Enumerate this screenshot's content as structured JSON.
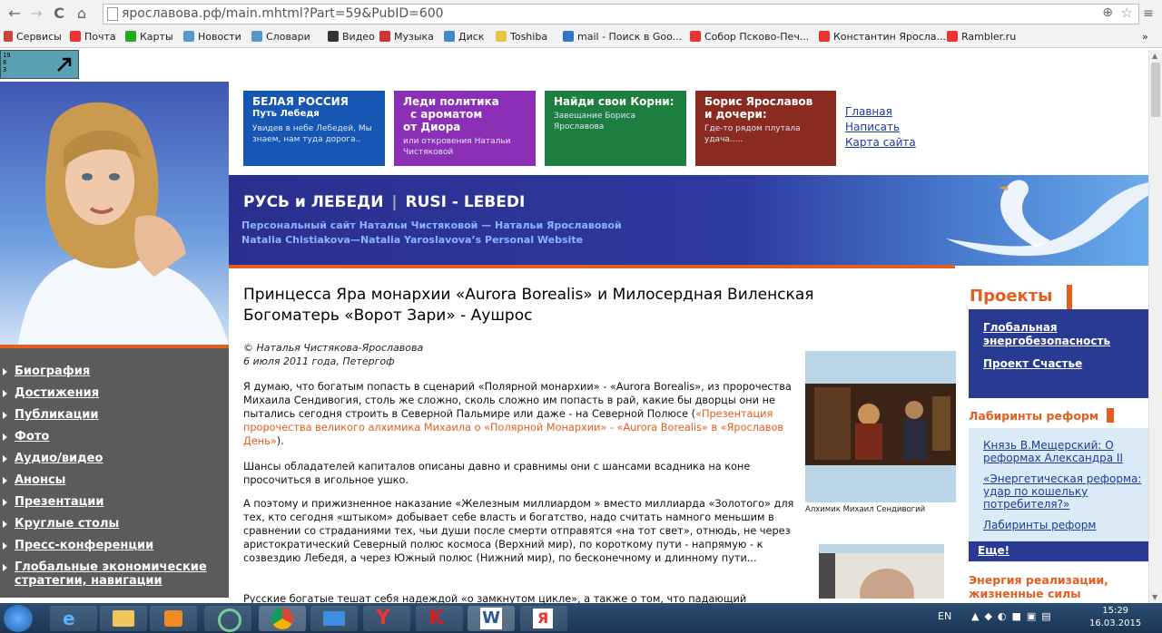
{
  "browser": {
    "url": "ярославова.рф/main.mhtml?Part=59&PubID=600",
    "bookmarks": [
      "Сервисы",
      "Почта",
      "Карты",
      "Новости",
      "Словари",
      "Видео",
      "Музыка",
      "Диск",
      "Toshiba",
      "mail - Поиск в Goo...",
      "Собор Псково-Печ...",
      "Константин Яросла...",
      "Rambler.ru"
    ],
    "bookmarks_more": "»"
  },
  "corner_badge": "19 8 3",
  "tiles": [
    {
      "title": "БЕЛАЯ  РОССИЯ",
      "title2": "Путь Лебедя",
      "sub": "Увидев в небе Лебедей, Мы знаем, нам туда дорога..",
      "color": "#1657b3"
    },
    {
      "title": "Леди  политика",
      "title2": "с  ароматом",
      "title3": "от Диора",
      "sub": "или откровения  Натальи Чистяковой",
      "color": "#8a2fb6"
    },
    {
      "title": "Найди свои Корни:",
      "sub": "Завещание Бориса Ярославова",
      "color": "#1d7e3f"
    },
    {
      "title": "Борис Ярославов",
      "title2": "и дочери:",
      "sub": "Где-то рядом плутала удача.....",
      "color": "#8b2a1e"
    }
  ],
  "toplinks": [
    "Главная",
    "Написать",
    "Карта сайта"
  ],
  "banner": {
    "title": "РУСЬ и ЛЕБЕДИ",
    "title_sep": "|",
    "title_en": "RUSI - LEBEDI",
    "sub1": "Персональный сайт Натальи Чистяковой — Натальи Ярославовой",
    "sub2": "Natalia Chistiakova—Natalia Yaroslavova’s  Personal Website"
  },
  "nav": [
    "Биография",
    "Достижения",
    "Публикации",
    "Фото",
    "Аудио/видео",
    "Анонсы",
    "Презентации",
    "Круглые столы",
    "Пресс-конференции",
    "Глобальные экономические",
    "стратегии, навигации"
  ],
  "article": {
    "title1": "Принцесса Яра монархии «Aurora Borealis» и Милосердная Виленская",
    "title2": "Богоматерь «Ворот Зари» - Аушрос",
    "author": "© Наталья Чистякова-Ярославова",
    "date": "6 июля 2011 года, Петергоф",
    "p1": "Я думаю, что богатым попасть в сценарий «Полярной монархии» - «Aurora Borealis», из пророчества Михаила Сендивогия, столь же сложно, сколь сложно им попасть в рай, какие бы дворцы они не пытались сегодня строить в Северной Пальмире или даже - на Северной Полюсе (",
    "p1_link": "«Презентация пророчества великого алхимика Михаила о «Полярной Монархии» - «Aurora Borealis» в «Ярославов День»",
    "p1_end": ").",
    "p2": "Шансы обладателей капиталов описаны давно и сравнимы они с шансами всадника на коне просочиться в игольное ушко.",
    "p3": "А поэтому и прижизненное наказание «Железным миллиардом » вместо миллиарда «Золотого» для тех, кто сегодня «штыком» добывает себе власть и богатство, надо считать намного меньшим в сравнении со страданиями тех, чьи души после смерти отправятся «на тот свет», отнюдь, не через аристократический Северный полюс космоса (Верхний мир), по короткому пути - напрямую - к созвездию Лебедя, а через Южный полюс (Нижний мир), по бесконечному и длинному пути...",
    "p4": "Русские богатые тешат себя надеждой «о замкнутом цикле», а также о том, что падающий",
    "caption": "Алхимик Михаил Сендивогий"
  },
  "right": {
    "projects_title": "Проекты",
    "projects": [
      "Глобальная",
      "энергобезопасность",
      "Проект Счастье"
    ],
    "lab_title": "Лабиринты реформ",
    "lab_links": [
      "Князь В.Мещерский: О",
      "реформах Александра II",
      "«Энергетическая реформа:",
      "удар по кошельку",
      "потребителя?»",
      "Лабиринты реформ"
    ],
    "more": "Еще!",
    "energy1": "Энергия реализации,",
    "energy2": "жизненные силы"
  },
  "taskbar": {
    "lang": "EN",
    "time": "15:29",
    "date": "16.03.2015"
  },
  "colors": {
    "accent": "#e25e21",
    "navy": "#283a92",
    "link": "#1a3d99",
    "nav_bg": "#5b5b5b"
  }
}
